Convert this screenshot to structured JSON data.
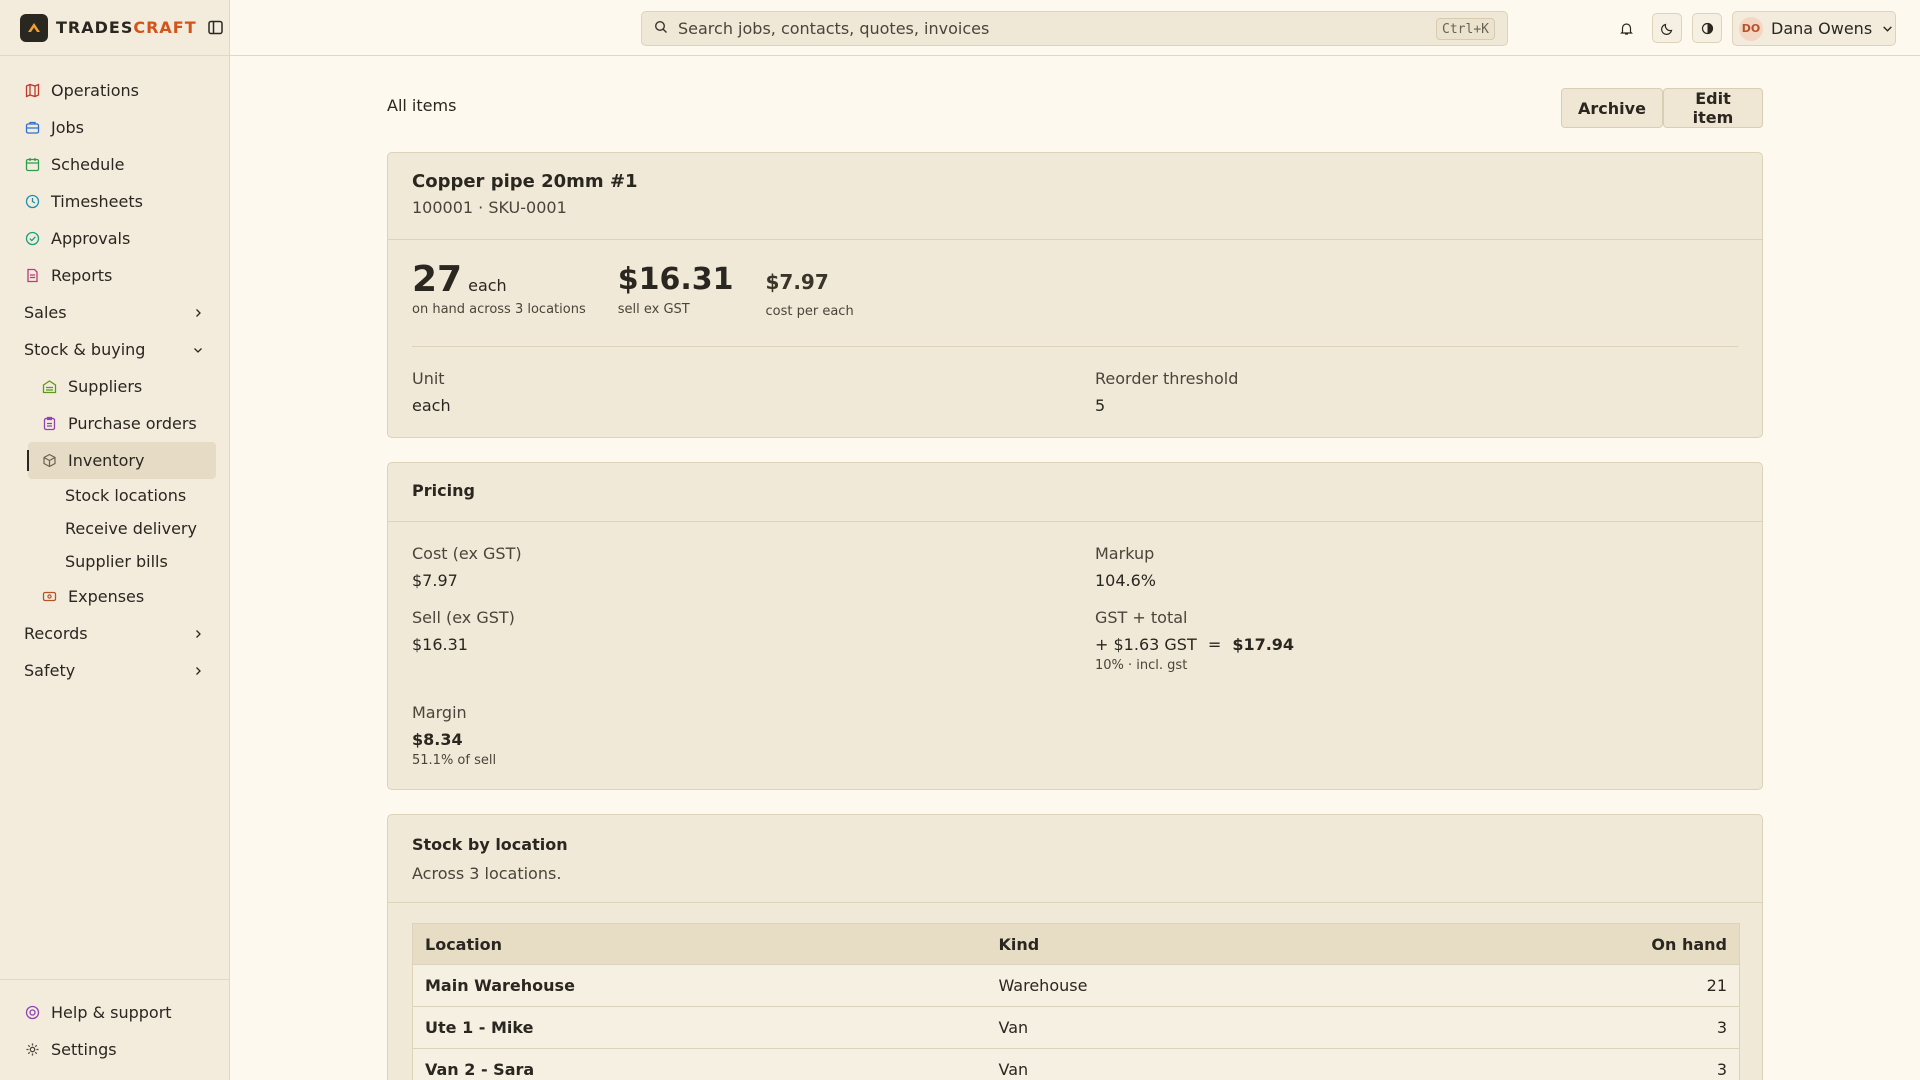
{
  "brand": {
    "name_main": "TRADES",
    "name_accent": "CRAFT"
  },
  "sidebar": {
    "items": [
      {
        "label": "Operations",
        "icon": "map-icon",
        "color": "#c0392b"
      },
      {
        "label": "Jobs",
        "icon": "briefcase-icon",
        "color": "#2e6fd0"
      },
      {
        "label": "Schedule",
        "icon": "calendar-icon",
        "color": "#2e9d4a"
      },
      {
        "label": "Timesheets",
        "icon": "clock-icon",
        "color": "#1f8fb0"
      },
      {
        "label": "Approvals",
        "icon": "check-circle-icon",
        "color": "#18a07a"
      },
      {
        "label": "Reports",
        "icon": "report-icon",
        "color": "#c2367a"
      }
    ],
    "groups": {
      "sales": "Sales",
      "stock": "Stock & buying",
      "records": "Records",
      "safety": "Safety"
    },
    "stock_items": {
      "suppliers": "Suppliers",
      "purchase_orders": "Purchase orders",
      "inventory": "Inventory",
      "stock_locations": "Stock locations",
      "receive_delivery": "Receive delivery",
      "supplier_bills": "Supplier bills",
      "expenses": "Expenses"
    },
    "bottom": {
      "help": "Help & support",
      "settings": "Settings"
    }
  },
  "topbar": {
    "search_placeholder": "Search jobs, contacts, quotes, invoices",
    "shortcut": "Ctrl+K",
    "user_initials": "DO",
    "user_name": "Dana Owens"
  },
  "page": {
    "breadcrumb": "All items",
    "archive_label": "Archive",
    "edit_label": "Edit item"
  },
  "item": {
    "name": "Copper pipe 20mm #1",
    "codes": "100001 · SKU-0001",
    "on_hand": "27",
    "on_hand_unit": "each",
    "on_hand_caption": "on hand across 3 locations",
    "sell": "$16.31",
    "sell_caption": "sell ex GST",
    "cost": "$7.97",
    "cost_caption": "cost per each",
    "unit_label": "Unit",
    "unit_value": "each",
    "reorder_label": "Reorder threshold",
    "reorder_value": "5"
  },
  "pricing": {
    "title": "Pricing",
    "cost_label": "Cost (ex GST)",
    "cost_value": "$7.97",
    "markup_label": "Markup",
    "markup_value": "104.6%",
    "sell_label": "Sell (ex GST)",
    "sell_value": "$16.31",
    "gst_label": "GST + total",
    "gst_value": "+ $1.63 GST",
    "gst_equals": "=",
    "gst_total": "$17.94",
    "gst_note": "10% · incl. gst",
    "margin_label": "Margin",
    "margin_value": "$8.34",
    "margin_note": "51.1% of sell"
  },
  "stock": {
    "title": "Stock by location",
    "subtitle": "Across 3 locations.",
    "columns": {
      "location": "Location",
      "kind": "Kind",
      "on_hand": "On hand"
    },
    "rows": [
      {
        "location": "Main Warehouse",
        "kind": "Warehouse",
        "on_hand": "21"
      },
      {
        "location": "Ute 1 - Mike",
        "kind": "Van",
        "on_hand": "3"
      },
      {
        "location": "Van 2 - Sara",
        "kind": "Van",
        "on_hand": "3"
      }
    ]
  }
}
